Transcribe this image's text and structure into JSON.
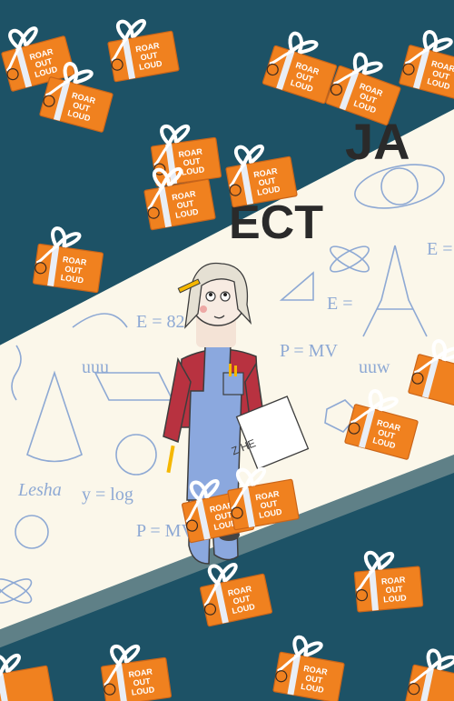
{
  "image": {
    "background_color": "#1d5266",
    "band_color": "#fbf7ea",
    "doodle_color": "#8ea9d4",
    "chalk_color": "#2a2a2a"
  },
  "headline_partial": {
    "line1": "JA",
    "line2": "ECT"
  },
  "gift_label": {
    "line1": "ROAR",
    "line2": "OUT",
    "line3": "LOUD"
  },
  "gift_colors": {
    "box": "#f0811f",
    "ribbon": "#e9eef5",
    "bow": "#ffffff"
  },
  "doodles": {
    "formulas": [
      "E = 82",
      "P = MV",
      "E =",
      "y = log",
      "P = MV",
      "E ="
    ],
    "scribbles": [
      "Lesha",
      "uuu",
      "uuw"
    ]
  },
  "girl": {
    "shirt_color": "#b83240",
    "overalls_color": "#8ba8de",
    "hair_color": "#e5e0d3",
    "paper_text": "Z HE"
  }
}
